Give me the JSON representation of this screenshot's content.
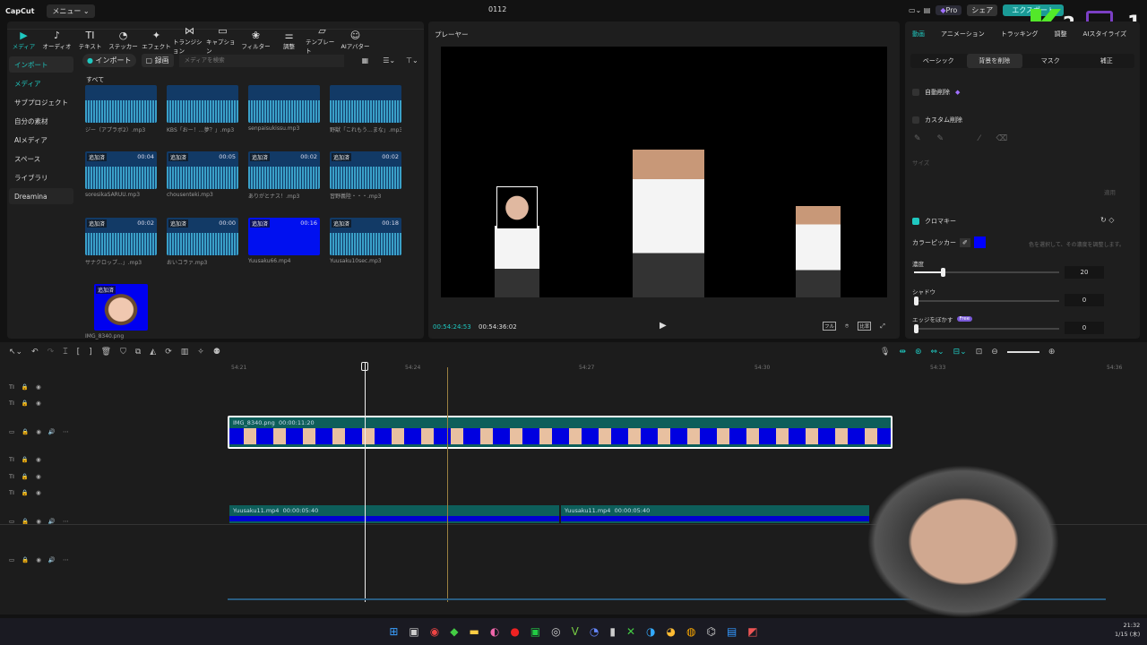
{
  "titlebar": {
    "app": "CapCut",
    "menu": "メニュー",
    "project": "0112",
    "pro": "Pro",
    "share": "シェア",
    "export": "エクスポート"
  },
  "toolbar": [
    {
      "icon": "media-icon",
      "label": "メディア"
    },
    {
      "icon": "audio-icon",
      "label": "オーディオ"
    },
    {
      "icon": "text-icon",
      "label": "テキスト"
    },
    {
      "icon": "sticker-icon",
      "label": "ステッカー"
    },
    {
      "icon": "effect-icon",
      "label": "エフェクト"
    },
    {
      "icon": "transition-icon",
      "label": "トランジション"
    },
    {
      "icon": "caption-icon",
      "label": "キャプション"
    },
    {
      "icon": "filter-icon",
      "label": "フィルター"
    },
    {
      "icon": "adjust-icon",
      "label": "調整"
    },
    {
      "icon": "template-icon",
      "label": "テンプレート"
    },
    {
      "icon": "ai-avatar-icon",
      "label": "AIアバター"
    }
  ],
  "sidebar": [
    {
      "label": "インポート"
    },
    {
      "label": "メディア"
    },
    {
      "label": "サブプロジェクト"
    },
    {
      "label": "自分の素材"
    },
    {
      "label": "AIメディア"
    },
    {
      "label": "スペース"
    },
    {
      "label": "ライブラリ"
    },
    {
      "label": "Dreamina"
    }
  ],
  "media": {
    "import": "インポート",
    "record": "録画",
    "search_placeholder": "メディアを検索",
    "section": "すべて",
    "added": "追加済",
    "items": [
      {
        "name": "ジー（アプラボ2）.mp3",
        "dur": "",
        "type": "audio"
      },
      {
        "name": "KBS「おー！…夢？」.mp3",
        "dur": "",
        "type": "audio"
      },
      {
        "name": "senpaisukissu.mp3",
        "dur": "",
        "type": "audio"
      },
      {
        "name": "野獣「これもう…まな」.mp3",
        "dur": "",
        "type": "audio"
      },
      {
        "name": "soresikaSARUU.mp3",
        "dur": "00:04",
        "type": "audio",
        "added": true
      },
      {
        "name": "chousenteki.mp3",
        "dur": "00:05",
        "type": "audio",
        "added": true
      },
      {
        "name": "ありがとナス！.mp3",
        "dur": "00:02",
        "type": "audio",
        "added": true
      },
      {
        "name": "習野義陸・・・.mp3",
        "dur": "00:02",
        "type": "audio",
        "added": true
      },
      {
        "name": "サナクロップ...」.mp3",
        "dur": "00:02",
        "type": "audio",
        "added": true
      },
      {
        "name": "おいコラァ.mp3",
        "dur": "00:00",
        "type": "audio",
        "added": true
      },
      {
        "name": "Yuusaku66.mp4",
        "dur": "00:16",
        "type": "video",
        "added": true
      },
      {
        "name": "Yuusaku10sec.mp3",
        "dur": "00:18",
        "type": "audio",
        "added": true
      },
      {
        "name": "IMG_8340.png",
        "dur": "",
        "type": "image",
        "added": true
      }
    ]
  },
  "player": {
    "title": "プレーヤー",
    "current": "00:54:24:53",
    "total": "00:54:36:02",
    "full": "フル",
    "ratio": "比率"
  },
  "right": {
    "tabs": [
      "動画",
      "アニメーション",
      "トラッキング",
      "調整",
      "AIスタイライズ"
    ],
    "subtabs": [
      "ベーシック",
      "背景を削除",
      "マスク",
      "補正"
    ],
    "auto_remove": "自動削除",
    "custom_remove": "カスタム削除",
    "size": "サイズ",
    "apply": "適用",
    "chroma": "クロマキー",
    "picker": "カラーピッカー",
    "picker_hint": "色を選択して、その濃度を調整します。",
    "picked_color": "#0000ff",
    "intensity": {
      "label": "濃度",
      "value": "20",
      "percent": 20
    },
    "shadow": {
      "label": "シャドウ",
      "value": "0"
    },
    "feather": {
      "label": "エッジをぼかす",
      "value": "0",
      "badge": "Free"
    }
  },
  "timeline": {
    "ruler": [
      "54:21",
      "54:24",
      "54:27",
      "54:30",
      "54:33",
      "54:36"
    ],
    "clip_main": {
      "name": "IMG_8340.png",
      "dur": "00:00:11:20"
    },
    "clips_bottom": [
      {
        "name": "Yuusaku11.mp4",
        "dur": "00:00:05:40"
      },
      {
        "name": "Yuusaku11.mp4",
        "dur": "00:00:05:40"
      }
    ]
  },
  "taskbar": {
    "time": "21:32",
    "date": "1/15 (木)"
  },
  "overlay": {
    "k2": "2",
    "one": "1"
  },
  "colors": {
    "accent": "#1fc8c0",
    "clip": "#0d5e5a",
    "chroma": "#0000ff"
  }
}
